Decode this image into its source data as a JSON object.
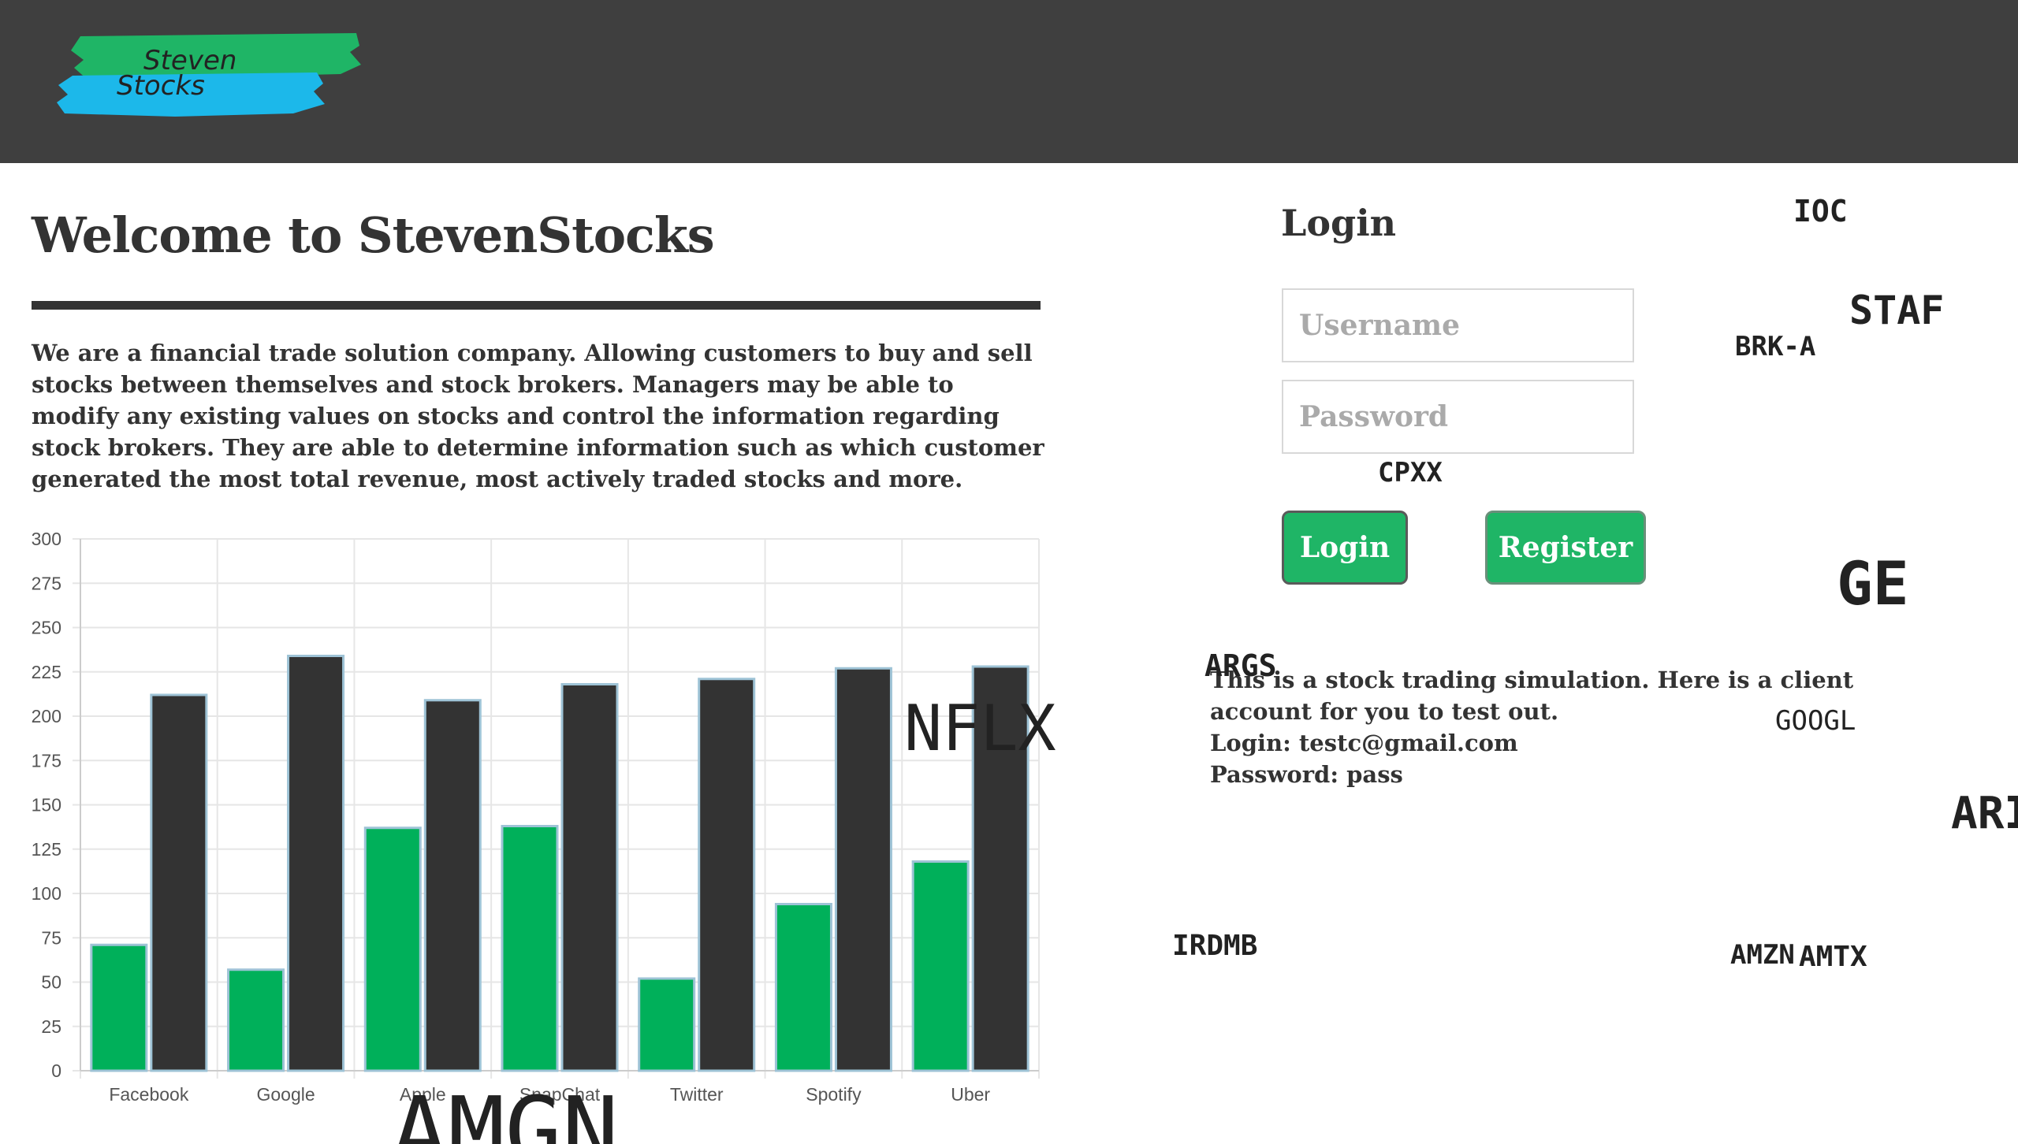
{
  "logo": {
    "line1": "Steven",
    "line2": "Stocks",
    "colors": {
      "top_stroke": "#1fb566",
      "bottom_stroke": "#1cb8ea"
    }
  },
  "welcome": {
    "title": "Welcome to StevenStocks",
    "intro": "We are a financial trade solution company. Allowing customers to buy and sell stocks between themselves and stock brokers. Managers may be able to modify any existing values on stocks and control the information regarding stock brokers. They are able to determine information such as which customer generated the most total revenue, most actively traded stocks and more."
  },
  "login": {
    "title": "Login",
    "username_placeholder": "Username",
    "password_placeholder": "Password",
    "login_label": "Login",
    "register_label": "Register"
  },
  "info": {
    "line1": "This is a stock trading simulation. Here is a client account for you to test out.",
    "line2": "Login: testc@gmail.com",
    "line3": "Password: pass"
  },
  "tickers": [
    "IOC",
    "STAF",
    "BRK-A",
    "CPXX",
    "GE",
    "ARGS",
    "GOOGL",
    "ARI",
    "IRDMB",
    "AMZN",
    "AMTX",
    "NFLX",
    "AMGN"
  ],
  "chart_data": {
    "type": "bar",
    "categories": [
      "Facebook",
      "Google",
      "Apple",
      "SnapChat",
      "Twitter",
      "Spotify",
      "Uber"
    ],
    "series": [
      {
        "values": [
          71,
          57,
          137,
          138,
          52,
          94,
          118
        ],
        "color": "#00b05a"
      },
      {
        "values": [
          212,
          234,
          209,
          218,
          221,
          227,
          228
        ],
        "color": "#333333"
      }
    ],
    "ylim": [
      0,
      300
    ],
    "yticks": [
      "0",
      "25",
      "50",
      "75",
      "100",
      "125",
      "150",
      "175",
      "200",
      "225",
      "250",
      "275",
      "300"
    ],
    "grid": true,
    "title": "",
    "xlabel": "",
    "ylabel": ""
  },
  "colors": {
    "header_bg": "#3f3f3f",
    "button_bg": "#1fb566",
    "text": "#333333"
  }
}
